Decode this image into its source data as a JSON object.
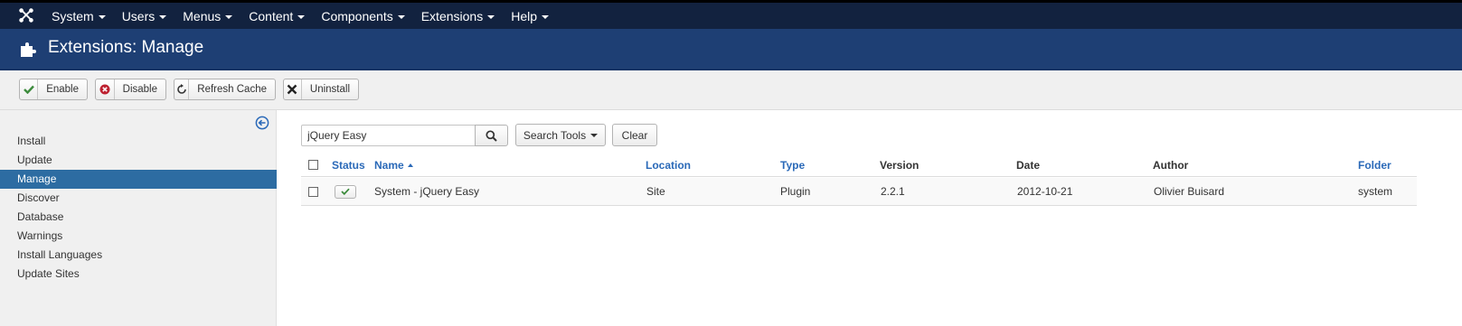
{
  "navbar": {
    "items": [
      {
        "label": "System"
      },
      {
        "label": "Users"
      },
      {
        "label": "Menus"
      },
      {
        "label": "Content"
      },
      {
        "label": "Components"
      },
      {
        "label": "Extensions"
      },
      {
        "label": "Help"
      }
    ]
  },
  "header": {
    "title": "Extensions: Manage"
  },
  "toolbar": {
    "enable": "Enable",
    "disable": "Disable",
    "refresh_cache": "Refresh Cache",
    "uninstall": "Uninstall"
  },
  "sidebar": {
    "items": [
      {
        "label": "Install"
      },
      {
        "label": "Update"
      },
      {
        "label": "Manage",
        "active": true
      },
      {
        "label": "Discover"
      },
      {
        "label": "Database"
      },
      {
        "label": "Warnings"
      },
      {
        "label": "Install Languages"
      },
      {
        "label": "Update Sites"
      }
    ]
  },
  "search": {
    "value": "jQuery Easy",
    "tools_label": "Search Tools",
    "clear_label": "Clear"
  },
  "table": {
    "headers": {
      "status": "Status",
      "name": "Name",
      "location": "Location",
      "type": "Type",
      "version": "Version",
      "date": "Date",
      "author": "Author",
      "folder": "Folder"
    },
    "rows": [
      {
        "name": "System - jQuery Easy",
        "location": "Site",
        "type": "Plugin",
        "version": "2.2.1",
        "date": "2012-10-21",
        "author": "Olivier Buisard",
        "folder": "system",
        "status": "enabled"
      }
    ]
  },
  "colors": {
    "navbar_bg": "#12223f",
    "titlebar_bg": "#1e3f74",
    "active_item": "#2d6ca2",
    "link": "#2a69b8",
    "success": "#3c8b3c",
    "danger": "#bd2130"
  }
}
